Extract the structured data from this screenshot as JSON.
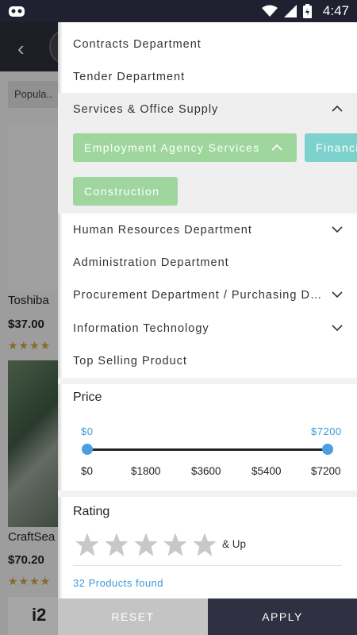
{
  "status_bar": {
    "time": "4:47"
  },
  "background": {
    "sort_label": "Popula..",
    "products": [
      {
        "title": "Toshiba",
        "price": "$37.00"
      },
      {
        "title": "CraftSea",
        "price": "$70.20"
      }
    ],
    "logo_text": "i2"
  },
  "filter": {
    "categories": [
      {
        "label": "Contracts Department"
      },
      {
        "label": "Tender Department"
      },
      {
        "label": "Services & Office Supply"
      },
      {
        "label": "Human Resources Department"
      },
      {
        "label": "Administration Department"
      },
      {
        "label": "Procurement Department / Purchasing Department"
      },
      {
        "label": "Information Technology"
      },
      {
        "label": "Top Selling Product"
      }
    ],
    "subcategories": [
      {
        "label": "Employment Agency Services"
      },
      {
        "label": "Financial Services"
      },
      {
        "label": "Construction"
      }
    ],
    "price": {
      "title": "Price",
      "min_label": "$0",
      "max_label": "$7200",
      "selected_min": 0,
      "selected_max": 7200,
      "ticks": [
        "$0",
        "$1800",
        "$3600",
        "$5400",
        "$7200"
      ]
    },
    "rating": {
      "title": "Rating",
      "suffix": "& Up",
      "stars_selected": 0,
      "stars_total": 5
    },
    "products_found": "32 Products found",
    "reset_label": "RESET",
    "apply_label": "APPLY"
  },
  "colors": {
    "chip_green": "#9fd69e",
    "chip_teal": "#7dd2ce",
    "accent_blue": "#3a9ad9",
    "apply_bg": "#2f3142"
  }
}
